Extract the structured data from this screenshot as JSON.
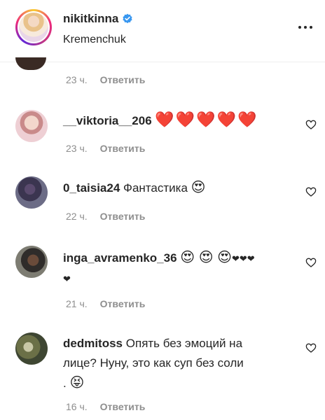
{
  "header": {
    "username": "nikitkinna",
    "location": "Kremenchuk"
  },
  "icons": {
    "verified": "verified-badge-icon",
    "more": "more-options-icon",
    "like": "heart-outline-icon"
  },
  "colors": {
    "verified": "#3897f0",
    "meta": "#8e8e8e",
    "heart_emoji": "#e1202e"
  },
  "first_meta": {
    "time": "23 ч.",
    "reply": "Ответить"
  },
  "comments": [
    {
      "username": "__viktoria__206",
      "text": "❤️❤️❤️❤️❤️",
      "time": "23 ч.",
      "reply": "Ответить"
    },
    {
      "username": "0_taisia24",
      "text": "Фантастика",
      "emoji": "😍",
      "time": "22 ч.",
      "reply": "Ответить"
    },
    {
      "username": "inga_avramenko_36",
      "emoji": "😍 😍 😍",
      "hearts_line1": "❤❤❤",
      "hearts_line2": "❤",
      "time": "21 ч.",
      "reply": "Ответить"
    },
    {
      "username": "dedmitoss",
      "text_line1": "Опять без эмоций на",
      "text_line2": "лице? Нуну, это как суп без соли",
      "text_line3": ".",
      "emoji": "😝",
      "time": "16 ч.",
      "reply": "Ответить"
    }
  ]
}
